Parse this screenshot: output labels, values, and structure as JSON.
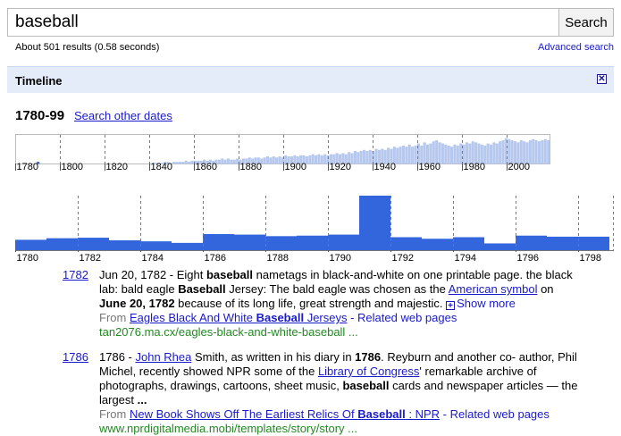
{
  "search": {
    "query": "baseball",
    "button_label": "Search"
  },
  "stats": "About 501 results (0.58 seconds)",
  "advanced_search": "Advanced search",
  "timeline": {
    "title": "Timeline",
    "close_icon": "close-icon",
    "close_glyph": "✕"
  },
  "range": {
    "label": "1780-99",
    "other_dates": "Search other dates"
  },
  "colors": {
    "link": "#1a1acc",
    "bar_overview": "#b6c8ee",
    "bar_selected": "#3366dd",
    "bar_detail": "#3366dd",
    "timeline_header": "#e5ecf9",
    "url_green": "#228822"
  },
  "overview": {
    "axis_labels": [
      "1780",
      "1800",
      "1820",
      "1840",
      "1860",
      "1880",
      "1900",
      "1920",
      "1940",
      "1960",
      "1980",
      "2000"
    ],
    "selected_start": 1780,
    "selected_end": 1799,
    "values": [
      0,
      0,
      0,
      0,
      0,
      0,
      0,
      2,
      0,
      0,
      0,
      0,
      0,
      0,
      0,
      0,
      0,
      0,
      0,
      0,
      0,
      0,
      0,
      0,
      0,
      0,
      0,
      0,
      0,
      0,
      0,
      0,
      1,
      0,
      0,
      0,
      0,
      0,
      0,
      0,
      0,
      0,
      0,
      0,
      0,
      1,
      1,
      1,
      1,
      2,
      2,
      1,
      2,
      2,
      2,
      2,
      3,
      2,
      3,
      3,
      3,
      3,
      4,
      3,
      4,
      3,
      4,
      4,
      5,
      4,
      5,
      4,
      4,
      5,
      4,
      5,
      5,
      6,
      5,
      6,
      6,
      5,
      6,
      7,
      6,
      7,
      6,
      7,
      6,
      8,
      7,
      7,
      8,
      7,
      8,
      8,
      7,
      8,
      9,
      8,
      9,
      8,
      9,
      8,
      9,
      9,
      10,
      9,
      10,
      9,
      11,
      10,
      12,
      11,
      12,
      13,
      12,
      13,
      12,
      14,
      13,
      14,
      13,
      15,
      14,
      16,
      15,
      16,
      17,
      16,
      18,
      16,
      17,
      19,
      17,
      20,
      18,
      19,
      21,
      22,
      20,
      19,
      18,
      17,
      16,
      18,
      17,
      19,
      18,
      20,
      19,
      21,
      20,
      19,
      18,
      17,
      19,
      18,
      20,
      19,
      21,
      22,
      24,
      23,
      22,
      21,
      20,
      22,
      21,
      20,
      22,
      23,
      22,
      21,
      22,
      23,
      22
    ]
  },
  "detail": {
    "axis_labels": [
      "1780",
      "1782",
      "1784",
      "1786",
      "1788",
      "1790",
      "1792",
      "1794",
      "1796",
      "1798"
    ],
    "values": [
      2,
      2.3,
      2.4,
      1.9,
      1.7,
      1.4,
      3.1,
      3,
      2.7,
      2.8,
      3,
      10.5,
      2.5,
      2.2,
      2.5,
      1.3,
      2.8,
      2.6,
      2.6
    ]
  },
  "results": [
    {
      "year": "1782",
      "snippet_parts": [
        {
          "t": "Jun 20, 1782 - Eight "
        },
        {
          "t": "baseball",
          "b": true
        },
        {
          "t": " nametags in black-and-white on one printable page. the black lab: bald eagle "
        },
        {
          "t": "Baseball",
          "b": true
        },
        {
          "t": " Jersey: The bald eagle was chosen as the "
        },
        {
          "t": "American symbol",
          "link": true
        },
        {
          "t": " on "
        },
        {
          "t": "June 20, 1782",
          "b": true
        },
        {
          "t": " because of its long life, great strength and majestic. "
        }
      ],
      "show_more": "Show more",
      "from_label": "From",
      "source_parts": [
        {
          "t": "Eagles Black And White "
        },
        {
          "t": "Baseball",
          "b": true
        },
        {
          "t": " Jerseys"
        }
      ],
      "related": "- Related web pages",
      "url": "tan2076.ma.cx/eagles-black-and-white-baseball ..."
    },
    {
      "year": "1786",
      "snippet_parts": [
        {
          "t": "1786 - "
        },
        {
          "t": "John Rhea",
          "link": true
        },
        {
          "t": " Smith, as written in his diary in "
        },
        {
          "t": "1786",
          "b": true
        },
        {
          "t": ". Reyburn and another co- author, Phil Michel, recently showed NPR some of the "
        },
        {
          "t": "Library of Congress",
          "link": true
        },
        {
          "t": "' remarkable archive of photographs, drawings, cartoons, sheet music, "
        },
        {
          "t": "baseball",
          "b": true
        },
        {
          "t": " cards and newspaper articles — the largest "
        },
        {
          "t": "...",
          "b": true
        }
      ],
      "from_label": "From",
      "source_parts": [
        {
          "t": "New Book Shows Off The Earliest Relics Of "
        },
        {
          "t": "Baseball",
          "b": true
        },
        {
          "t": " : NPR"
        }
      ],
      "related": "- Related web pages",
      "url": "www.nprdigitalmedia.mobi/templates/story/story ..."
    }
  ]
}
